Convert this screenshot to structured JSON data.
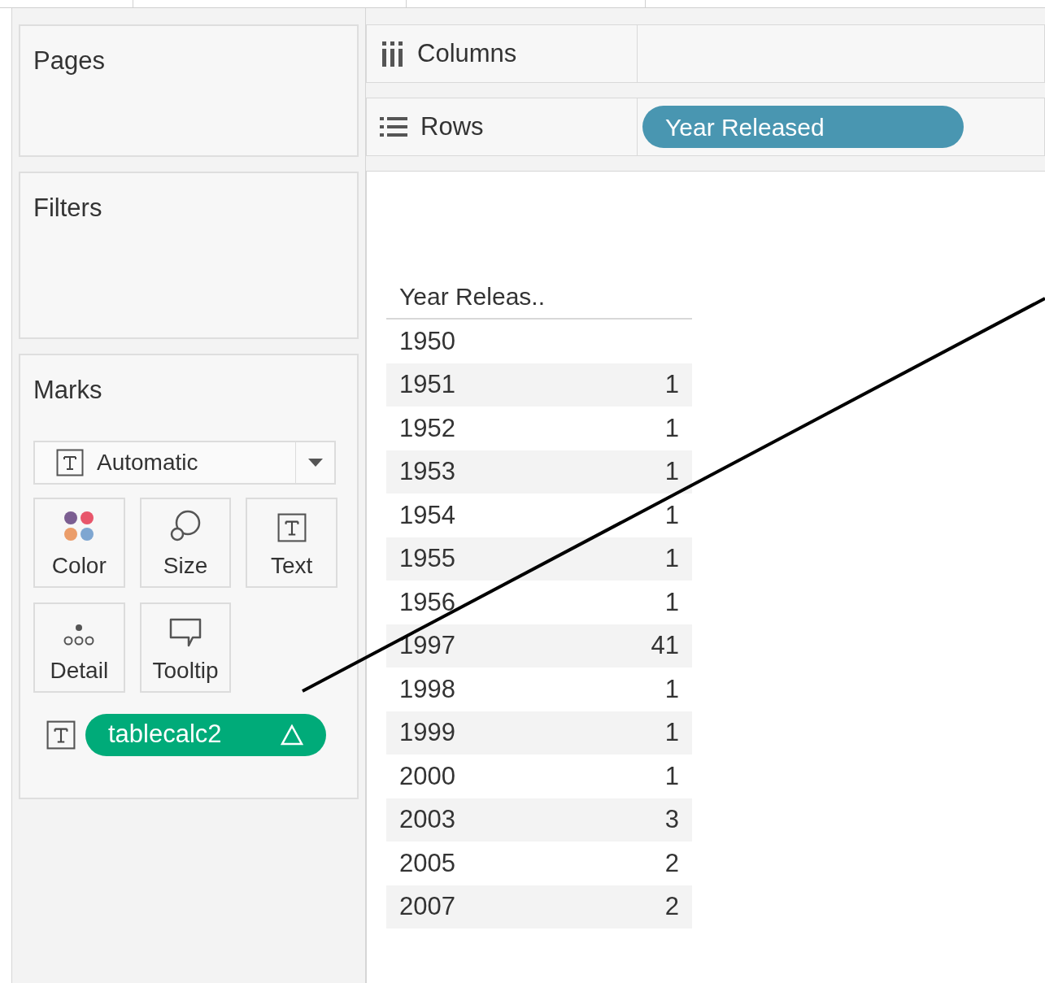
{
  "pages": {
    "title": "Pages"
  },
  "filters": {
    "title": "Filters"
  },
  "marks": {
    "title": "Marks",
    "mark_type": "Automatic",
    "cards": [
      {
        "kind": "color",
        "label": "Color"
      },
      {
        "kind": "size",
        "label": "Size"
      },
      {
        "kind": "text",
        "label": "Text"
      },
      {
        "kind": "detail",
        "label": "Detail"
      },
      {
        "kind": "tooltip",
        "label": "Tooltip"
      }
    ],
    "fields": [
      {
        "kind": "text",
        "name": "tablecalc2",
        "table_calc": true
      }
    ]
  },
  "columns_shelf": {
    "label": "Columns"
  },
  "rows_shelf": {
    "label": "Rows",
    "pills": [
      "Year Released"
    ]
  },
  "table": {
    "header": "Year Releas..",
    "rows": [
      {
        "year": "1950"
      },
      {
        "year": "1951",
        "value": "1"
      },
      {
        "year": "1952",
        "value": "1"
      },
      {
        "year": "1953",
        "value": "1"
      },
      {
        "year": "1954",
        "value": "1"
      },
      {
        "year": "1955",
        "value": "1"
      },
      {
        "year": "1956",
        "value": "1"
      },
      {
        "year": "1997",
        "value": "41"
      },
      {
        "year": "1998",
        "value": "1"
      },
      {
        "year": "1999",
        "value": "1"
      },
      {
        "year": "2000",
        "value": "1"
      },
      {
        "year": "2003",
        "value": "3"
      },
      {
        "year": "2005",
        "value": "2"
      },
      {
        "year": "2007",
        "value": "2"
      }
    ]
  }
}
